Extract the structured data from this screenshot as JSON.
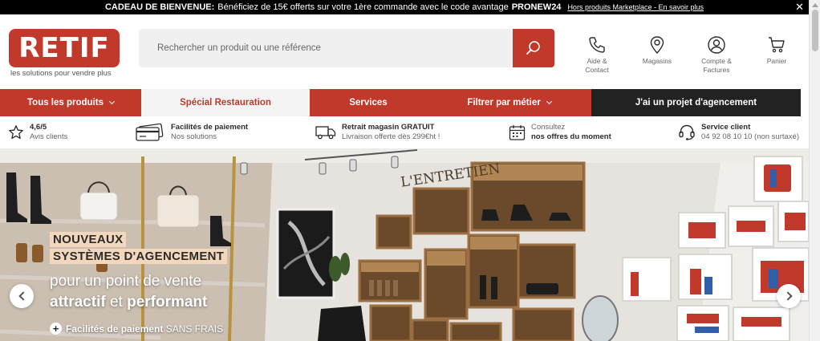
{
  "promo": {
    "prefix": "CADEAU DE BIENVENUE:",
    "text": "Bénéficiez de 15€ offerts sur votre 1ère commande avec le code avantage",
    "code": "PRONEW24",
    "link": "Hors produits Marketplace - En savoir plus",
    "close": "✕"
  },
  "header": {
    "logo": "RETIF",
    "tagline": "les solutions pour vendre plus",
    "search_placeholder": "Rechercher un produit ou une référence",
    "icons": [
      {
        "label": "Aide &\nContact",
        "icon": "phone-icon"
      },
      {
        "label": "Magasins",
        "icon": "map-pin-icon"
      },
      {
        "label": "Compte &\nFactures",
        "icon": "user-icon"
      },
      {
        "label": "Panier",
        "icon": "cart-icon"
      }
    ]
  },
  "nav": {
    "items": [
      {
        "label": "Tous les produits"
      },
      {
        "label": "Spécial Restauration"
      },
      {
        "label": "Services"
      },
      {
        "label": "Filtrer par métier"
      },
      {
        "label": "J'ai un projet d'agencement"
      }
    ]
  },
  "reassurance": [
    {
      "line1": "4,6/5",
      "line2": "Avis clients",
      "icon": "star-icon"
    },
    {
      "line1": "Facilités de paiement",
      "line2": "Nos solutions",
      "icon": "credit-card-icon"
    },
    {
      "line1": "Retrait magasin GRATUIT",
      "line2": "Livraison offerte dès 299€ht !",
      "icon": "truck-icon"
    },
    {
      "line1": "Consultez",
      "line2": "nos offres du moment",
      "icon": "calendar-icon"
    },
    {
      "line1": "Service client",
      "line2": "04 92 08 10 10 (non surtaxé)",
      "icon": "headset-icon"
    }
  ],
  "hero": {
    "badge1": "NOUVEAUX",
    "badge2": "SYSTÈMES D'AGENCEMENT",
    "line1": "pour un point de vente",
    "line2_bold1": "attractif",
    "line2_mid": " et ",
    "line2_bold2": "performant",
    "note_prefix": "Facilités de paiement",
    "note_suffix": " SANS FRAIS",
    "plus": "+",
    "wall_sign": "L'ENTRETIEN"
  },
  "colors": {
    "brand_red": "#c0392b",
    "dark": "#222222",
    "badge_bg": "#f3d7bd"
  }
}
